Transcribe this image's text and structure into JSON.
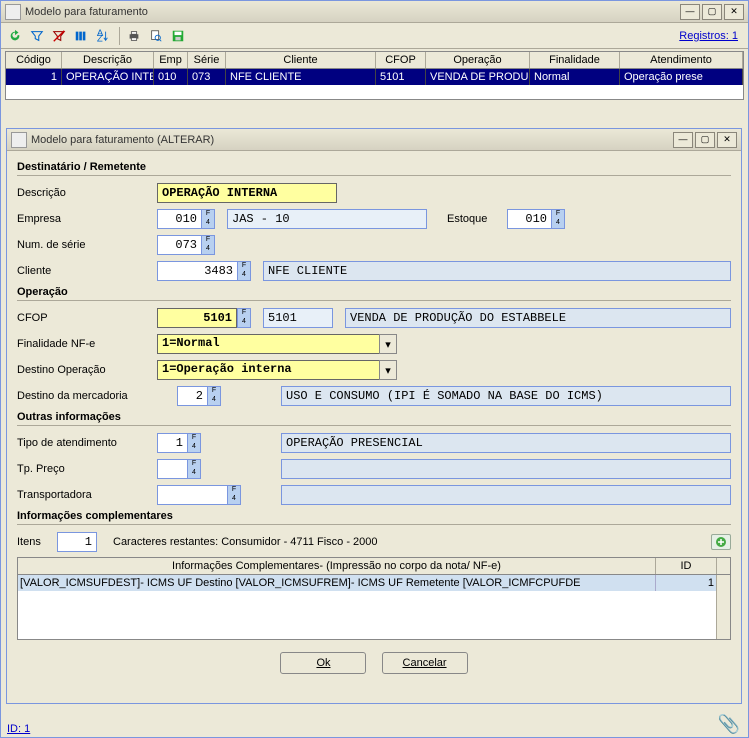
{
  "main": {
    "title": "Modelo para faturamento",
    "registros": "Registros: 1"
  },
  "grid": {
    "headers": [
      "Código",
      "Descrição",
      "Emp",
      "Série",
      "Cliente",
      "CFOP",
      "Operação",
      "Finalidade",
      "Atendimento"
    ],
    "row": [
      "1",
      "OPERAÇÃO INTE",
      "010",
      "073",
      "NFE CLIENTE",
      "5101",
      "VENDA DE PRODU",
      "Normal",
      "Operação prese"
    ]
  },
  "dialog": {
    "title": "Modelo para faturamento (ALTERAR)",
    "sections": {
      "dest": "Destinatário / Remetente",
      "oper": "Operação",
      "outras": "Outras informações",
      "info": "Informações complementares"
    },
    "labels": {
      "descricao": "Descrição",
      "empresa": "Empresa",
      "numserie": "Num. de série",
      "cliente": "Cliente",
      "estoque": "Estoque",
      "cfop": "CFOP",
      "finalidade": "Finalidade NF-e",
      "destoper": "Destino Operação",
      "destmerc": "Destino da mercadoria",
      "tipoatend": "Tipo de atendimento",
      "tppreco": "Tp. Preço",
      "transp": "Transportadora",
      "itens": "Itens",
      "caracteres": "Caracteres restantes:    Consumidor - 4711    Fisco - 2000"
    },
    "values": {
      "descricao": "OPERAÇÃO INTERNA",
      "empresa": "010",
      "empresa_nome": "JAS - 10",
      "estoque": "010",
      "numserie": "073",
      "cliente": "3483",
      "cliente_nome": "NFE CLIENTE",
      "cfop": "5101",
      "cfop2": "5101",
      "cfop_desc": "VENDA DE PRODUÇÃO DO ESTABBELE",
      "finalidade": "1=Normal",
      "destoper": "1=Operação interna",
      "destmerc": "2",
      "destmerc_desc": "USO E CONSUMO (IPI É SOMADO NA BASE DO ICMS)",
      "tipoatend": "1",
      "tipoatend_desc": "OPERAÇÃO PRESENCIAL",
      "tppreco": "",
      "transp": "",
      "itens": "1"
    },
    "ictable": {
      "hdr1": "Informações Complementares- (Impressão no corpo da nota/ NF-e)",
      "hdr2": "ID",
      "row1": "[VALOR_ICMSUFDEST]- ICMS UF Destino [VALOR_ICMSUFREM]- ICMS UF Remetente [VALOR_ICMFCPUFDE",
      "row1_id": "1"
    },
    "buttons": {
      "ok": "Ok",
      "cancel": "Cancelar"
    }
  },
  "footer": {
    "id": "ID: 1"
  }
}
